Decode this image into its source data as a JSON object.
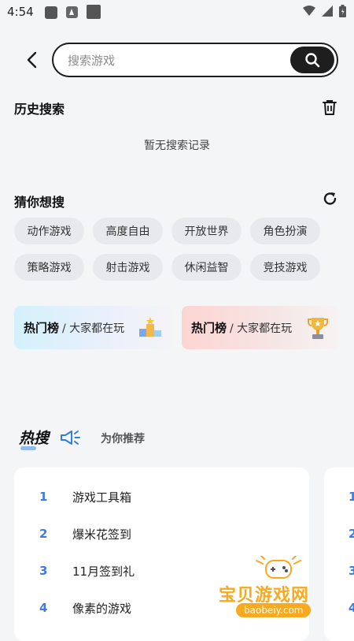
{
  "status_bar": {
    "time": "4:54"
  },
  "search": {
    "placeholder": "搜索游戏",
    "value": ""
  },
  "history": {
    "title": "历史搜索",
    "empty_text": "暂无搜索记录"
  },
  "guess": {
    "title": "猜你想搜",
    "tags": [
      "动作游戏",
      "高度自由",
      "开放世界",
      "角色扮演",
      "策略游戏",
      "射击游戏",
      "休闲益智",
      "竞技游戏"
    ]
  },
  "rank_cards": [
    {
      "title": "热门榜",
      "subtitle": "/ 大家都在玩"
    },
    {
      "title": "热门榜",
      "subtitle": "/ 大家都在玩"
    }
  ],
  "hot": {
    "title": "热搜",
    "tab2": "为你推荐",
    "list": [
      {
        "rank": "1",
        "name": "游戏工具箱"
      },
      {
        "rank": "2",
        "name": "爆米花签到"
      },
      {
        "rank": "3",
        "name": "11月签到礼"
      },
      {
        "rank": "4",
        "name": "像素的游戏"
      }
    ],
    "list2_ranks": [
      "1",
      "2",
      "3",
      "4"
    ]
  },
  "watermark": {
    "name": "宝贝游戏网",
    "url": "baobeiy.com"
  },
  "colors": {
    "accent": "#3d7be0",
    "watermark": "#f7a91f",
    "search_border": "#1c1c1c"
  }
}
